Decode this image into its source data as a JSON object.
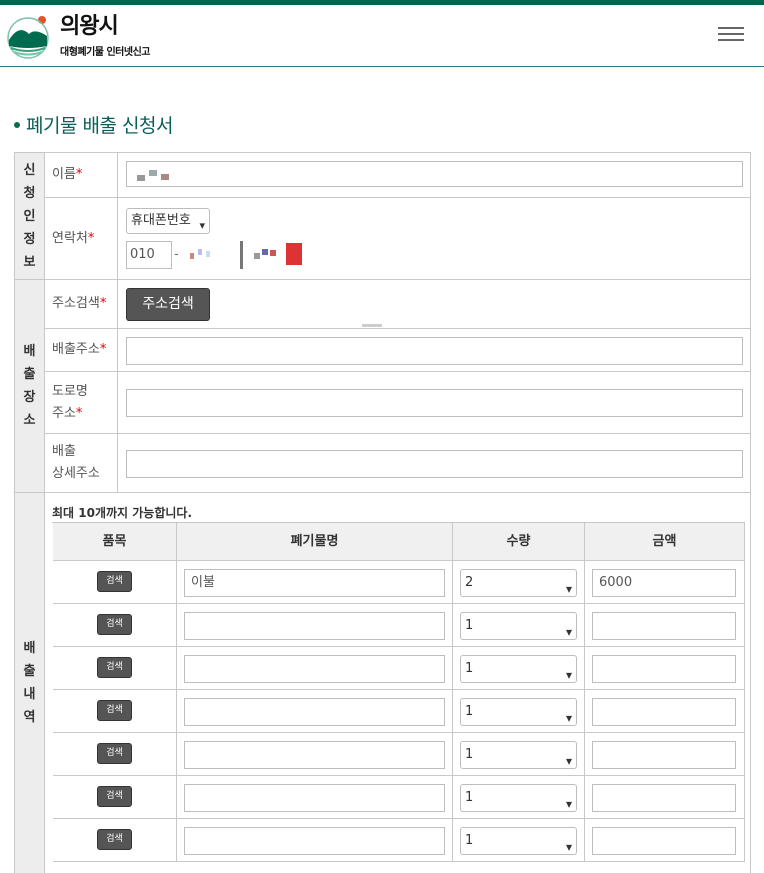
{
  "header": {
    "logo_title": "의왕시",
    "logo_subtitle": "대형폐기물 인터넷신고",
    "logo_icon": "mountain-emblem-icon",
    "menu_icon": "hamburger-menu-icon",
    "colors": {
      "brand_green": "#00664c",
      "title_teal": "#0b5f58",
      "required_red": "#dd0000"
    }
  },
  "page_title": "폐기물 배출 신청서",
  "sections": {
    "applicant": "신청인정보",
    "location": "배출장소",
    "details": "배출내역"
  },
  "fields": {
    "name_label": "이름",
    "contact_label": "연락처",
    "phone_type": "휴대폰번호",
    "phone_prefix": "010",
    "phone_dash": "-",
    "address_search_label": "주소검색",
    "address_search_button": "주소검색",
    "discharge_address_label": "배출주소",
    "road_address_label_1": "도로명",
    "road_address_label_2": "주소",
    "detail_address_label_1": "배출",
    "detail_address_label_2": "상세주소",
    "required_mark": "*"
  },
  "items": {
    "note": "최대 10개까지 가능합니다.",
    "headers": [
      "품목",
      "폐기물명",
      "수량",
      "금액"
    ],
    "search_button": "검색",
    "rows": [
      {
        "name": "이불",
        "qty": "2",
        "amount": "6000"
      },
      {
        "name": "",
        "qty": "1",
        "amount": ""
      },
      {
        "name": "",
        "qty": "1",
        "amount": ""
      },
      {
        "name": "",
        "qty": "1",
        "amount": ""
      },
      {
        "name": "",
        "qty": "1",
        "amount": ""
      },
      {
        "name": "",
        "qty": "1",
        "amount": ""
      },
      {
        "name": "",
        "qty": "1",
        "amount": ""
      }
    ]
  }
}
